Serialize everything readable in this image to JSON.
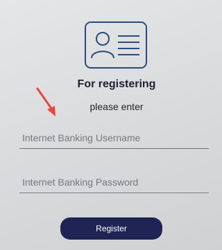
{
  "header": {
    "icon": "id-card-icon",
    "title": "For registering",
    "subtitle": "please enter"
  },
  "form": {
    "username_placeholder": "Internet Banking Username",
    "password_placeholder": "Internet Banking Password",
    "register_label": "Register"
  },
  "annotation": {
    "icon": "red-arrow-icon"
  },
  "colors": {
    "accent": "#1f2454",
    "icon_blue": "#2a4a7a",
    "arrow_red": "#e8473f"
  }
}
